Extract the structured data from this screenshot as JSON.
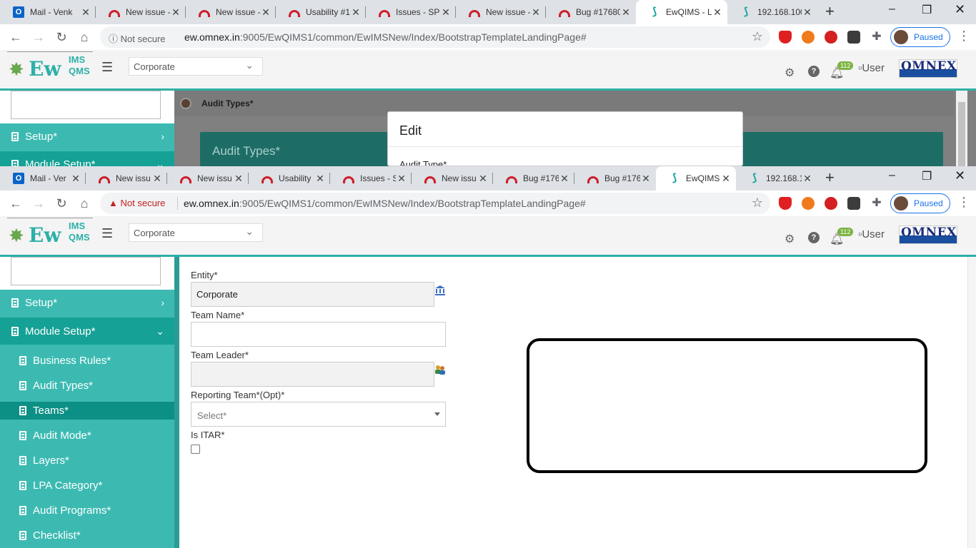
{
  "browser_back": {
    "tabs": [
      {
        "label": "Mail - Venk",
        "favicon": "outlook-icon"
      },
      {
        "label": "New issue -",
        "favicon": "arc-icon"
      },
      {
        "label": "New issue -",
        "favicon": "arc-icon"
      },
      {
        "label": "Usability #1",
        "favicon": "arc-icon"
      },
      {
        "label": "Issues - SP",
        "favicon": "arc-icon"
      },
      {
        "label": "New issue -",
        "favicon": "arc-icon"
      },
      {
        "label": "Bug #17680",
        "favicon": "arc-icon"
      },
      {
        "label": "EwQIMS - L",
        "favicon": "ewqims-icon",
        "active": true
      },
      {
        "label": "192.168.100",
        "favicon": "ewqims-icon"
      }
    ],
    "security_label": "Not secure",
    "url_host": "ew.omnex.in",
    "url_path": ":9005/EwQIMS1/common/EwIMSNew/Index/BootstrapTemplateLandingPage#",
    "profile_label": "Paused"
  },
  "browser_front": {
    "tabs": [
      {
        "label": "Mail - Ver",
        "favicon": "outlook-icon"
      },
      {
        "label": "New issu",
        "favicon": "arc-icon"
      },
      {
        "label": "New issu",
        "favicon": "arc-icon"
      },
      {
        "label": "Usability",
        "favicon": "arc-icon"
      },
      {
        "label": "Issues - S",
        "favicon": "arc-icon"
      },
      {
        "label": "New issu",
        "favicon": "arc-icon"
      },
      {
        "label": "Bug #176",
        "favicon": "arc-icon"
      },
      {
        "label": "Bug #176",
        "favicon": "arc-icon"
      },
      {
        "label": "EwQIMS",
        "favicon": "ewqims-icon",
        "active": true
      },
      {
        "label": "192.168.1",
        "favicon": "ewqims-icon"
      }
    ],
    "security_label": "Not secure",
    "url_host": "ew.omnex.in",
    "url_path": ":9005/EwQIMS1/common/EwIMSNew/Index/BootstrapTemplateLandingPage#",
    "profile_label": "Paused"
  },
  "app": {
    "logo_ew": "Ew",
    "logo_ims": "IMS",
    "logo_qms": "QMS",
    "entity_selected": "Corporate",
    "notification_count": "112",
    "user_label": "User",
    "brand": "OMNEX"
  },
  "ghost_page": {
    "breadcrumb": "Audit Types*",
    "panel_title": "Audit Types*",
    "modal_title": "Edit",
    "modal_field_label": "Audit Type*"
  },
  "sidebar": {
    "top_items": [
      {
        "label": "Setup*",
        "expanded": false
      },
      {
        "label": "Module Setup*",
        "expanded": true
      }
    ],
    "sub_items": [
      {
        "label": "Business Rules*"
      },
      {
        "label": "Audit Types*"
      },
      {
        "label": "Teams*",
        "active": true
      },
      {
        "label": "Audit Mode*"
      },
      {
        "label": "Layers*"
      },
      {
        "label": "LPA Category*"
      },
      {
        "label": "Audit Programs*"
      },
      {
        "label": "Checklist*"
      }
    ]
  },
  "form": {
    "entity_label": "Entity*",
    "entity_value": "Corporate",
    "team_name_label": "Team Name*",
    "team_name_value": "",
    "team_leader_label": "Team Leader*",
    "team_leader_value": "",
    "reporting_team_label": "Reporting Team*(Opt)*",
    "reporting_team_placeholder": "Select*",
    "is_itar_label": "Is ITAR*",
    "is_itar_checked": false
  },
  "colors": {
    "sidebar": "#3cbab2",
    "sidebar_active": "#0c8f85",
    "header_accent": "#2db0a8",
    "ghost_panel": "#1d6d66"
  }
}
